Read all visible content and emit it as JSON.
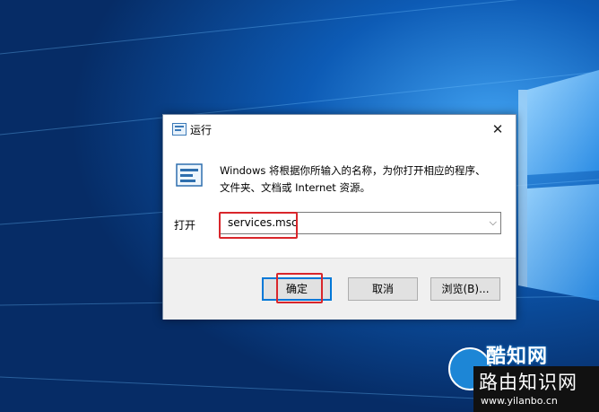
{
  "dialog": {
    "title": "运行",
    "description_line1": "Windows 将根据你所输入的名称，为你打开相应的程序、",
    "description_line2": "文件夹、文档或 Internet 资源。",
    "open_label": "打开",
    "open_value": "services.msc",
    "ok_label": "确定",
    "cancel_label": "取消",
    "browse_label": "浏览(B)...",
    "close_glyph": "✕"
  },
  "watermark": {
    "logo_text": "酷知网",
    "site_name": "路由知识网",
    "url": "www.yilanbo.cn"
  },
  "colors": {
    "highlight": "#d9262b",
    "default_button_border": "#0078d7",
    "desktop_background": "#0a3f86"
  }
}
